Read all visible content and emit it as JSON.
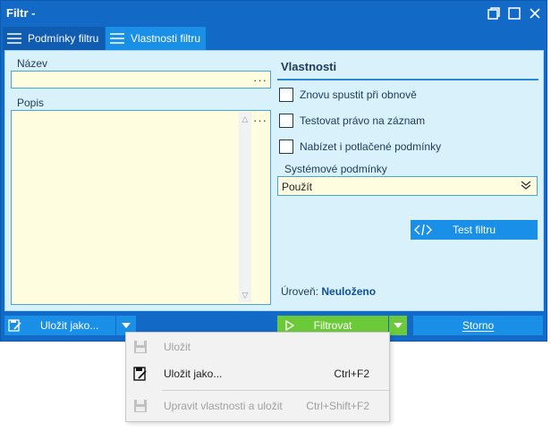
{
  "window": {
    "title": "Filtr -"
  },
  "tabs": [
    {
      "label": "Podmínky filtru",
      "active": false
    },
    {
      "label": "Vlastnosti filtru",
      "active": true
    }
  ],
  "form": {
    "name_label": "Název",
    "name_value": "",
    "desc_label": "Popis",
    "desc_value": "",
    "ellipsis": "···"
  },
  "properties": {
    "title": "Vlastnosti",
    "checkboxes": [
      {
        "label": "Znovu spustit při obnově",
        "checked": false
      },
      {
        "label": "Testovat právo na záznam",
        "checked": false
      },
      {
        "label": "Nabízet i potlačené podmínky",
        "checked": false
      }
    ],
    "system_conditions_label": "Systémové podmínky",
    "system_conditions_value": "Použít",
    "test_button": "Test filtru",
    "level_label": "Úroveň:",
    "level_value": "Neuloženo"
  },
  "bottom": {
    "save_as": "Uložit jako...",
    "filter": "Filtrovat",
    "cancel": "Storno"
  },
  "menu": {
    "items": [
      {
        "label": "Uložit",
        "shortcut": "",
        "enabled": false
      },
      {
        "label": "Uložit jako...",
        "shortcut": "Ctrl+F2",
        "enabled": true
      },
      {
        "label": "Upravit vlastnosti a uložit",
        "shortcut": "Ctrl+Shift+F2",
        "enabled": false
      }
    ]
  },
  "colors": {
    "title_bar": "#1369c6",
    "tab_active": "#1a8fe8",
    "panel_bg": "#d9f1fb",
    "field_bg": "#fffde0",
    "filter_button": "#6cc93a"
  }
}
